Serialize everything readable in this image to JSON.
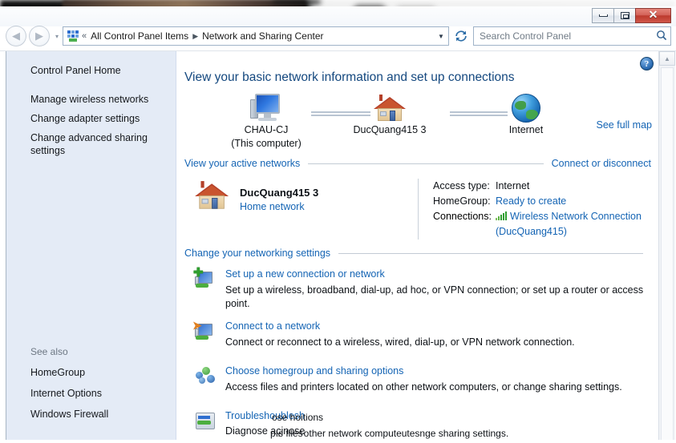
{
  "window": {
    "min_label": "Minimize",
    "max_label": "Maximize",
    "close_label": "✕"
  },
  "nav": {
    "back_glyph": "◀",
    "forward_glyph": "▶",
    "recent_glyph": "▾",
    "addr_chevron": "«",
    "breadcrumbs": [
      "All Control Panel Items",
      "Network and Sharing Center"
    ],
    "breadcrumb_sep": "▶",
    "addr_caret": "▼",
    "refresh_glyph": "↻",
    "search_placeholder": "Search Control Panel",
    "search_value": "",
    "search_icon": "⌕"
  },
  "sidebar": {
    "home": "Control Panel Home",
    "items": [
      {
        "label": "Manage wireless networks"
      },
      {
        "label": "Change adapter settings"
      },
      {
        "label": "Change advanced sharing settings"
      }
    ],
    "see_also_title": "See also",
    "see_also": [
      {
        "label": "HomeGroup"
      },
      {
        "label": "Internet Options"
      },
      {
        "label": "Windows Firewall"
      }
    ]
  },
  "main": {
    "help_glyph": "?",
    "page_title": "View your basic network information and set up connections",
    "see_full_map": "See full map",
    "network_map": {
      "nodes": [
        {
          "icon": "computer-icon",
          "line1": "CHAU-CJ",
          "line2": "(This computer)"
        },
        {
          "icon": "house-icon",
          "line1": "DucQuang415  3",
          "line2": ""
        },
        {
          "icon": "globe-icon",
          "line1": "Internet",
          "line2": ""
        }
      ]
    },
    "active_networks": {
      "title": "View your active networks",
      "action": "Connect or disconnect",
      "network_name": "DucQuang415  3",
      "network_type": "Home network",
      "details": [
        {
          "key": "Access type:",
          "value": "Internet",
          "link": false
        },
        {
          "key": "HomeGroup:",
          "value": "Ready to create",
          "link": true
        }
      ],
      "connections_key": "Connections:",
      "connections_value_line1": "Wireless Network Connection",
      "connections_value_line2": "(DucQuang415)"
    },
    "settings": {
      "title": "Change your networking settings",
      "items": [
        {
          "icon": "new-connection-icon",
          "link": "Set up a new connection or network",
          "desc": "Set up a wireless, broadband, dial-up, ad hoc, or VPN connection; or set up a router or access point."
        },
        {
          "icon": "connect-network-icon",
          "link": "Connect to a network",
          "desc": "Connect or reconnect to a wireless, wired, dial-up, or VPN network connection."
        },
        {
          "icon": "homegroup-icon",
          "link": "Choose homegroup and sharing options",
          "desc": "Access files and printers located on other network computers, or change sharing settings."
        }
      ],
      "torn_item": {
        "icon": "troubleshoot-icon",
        "link_base": "Troubleshoublesh",
        "link_overlay": "ose hoitions",
        "desc_base": "Diagnose açinose",
        "desc_overlay": "pıs files other network computeutesnge sharing settings."
      }
    }
  },
  "scrollbar": {
    "up_glyph": "▲"
  }
}
